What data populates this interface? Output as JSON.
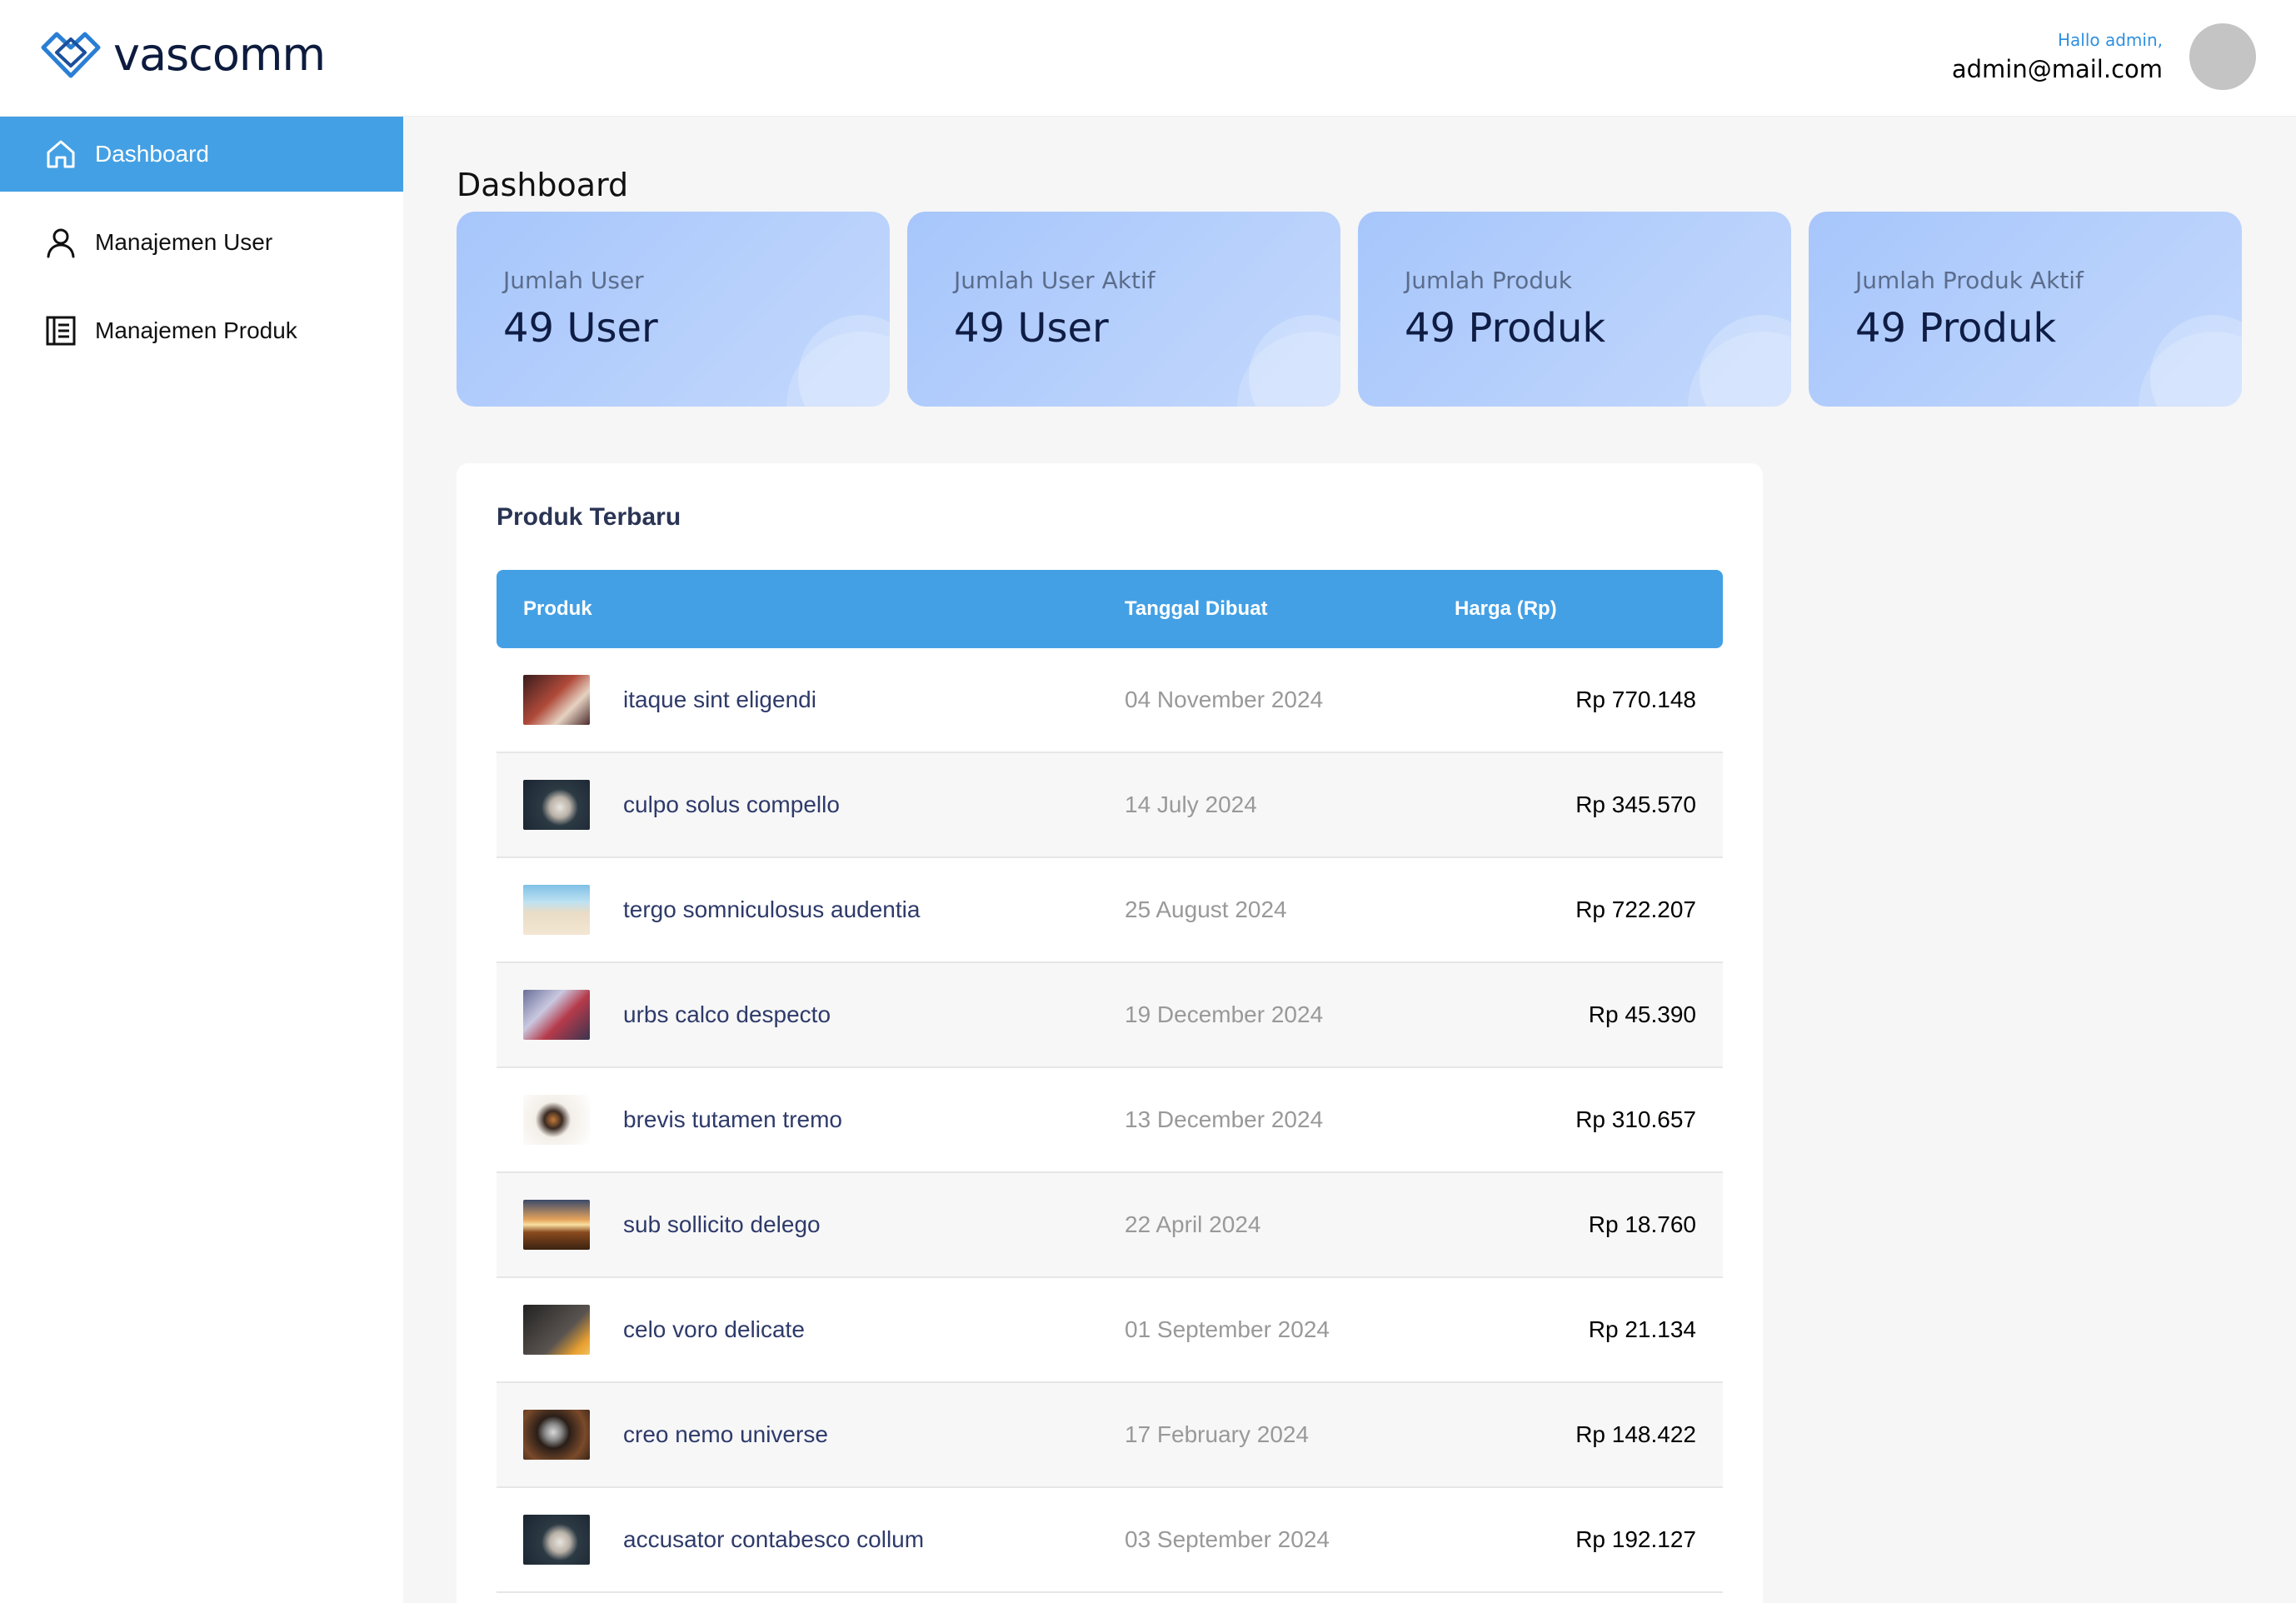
{
  "brand": {
    "name": "vascomm"
  },
  "header": {
    "greeting": "Hallo admin,",
    "email": "admin@mail.com"
  },
  "sidebar": {
    "items": [
      {
        "label": "Dashboard",
        "icon": "home-icon",
        "active": true
      },
      {
        "label": "Manajemen User",
        "icon": "user-icon",
        "active": false
      },
      {
        "label": "Manajemen Produk",
        "icon": "document-icon",
        "active": false
      }
    ]
  },
  "main": {
    "title": "Dashboard",
    "stats": [
      {
        "label": "Jumlah User",
        "value": "49 User"
      },
      {
        "label": "Jumlah User Aktif",
        "value": "49 User"
      },
      {
        "label": "Jumlah Produk",
        "value": "49 Produk"
      },
      {
        "label": "Jumlah Produk Aktif",
        "value": "49 Produk"
      }
    ],
    "products": {
      "title": "Produk Terbaru",
      "columns": [
        "Produk",
        "Tanggal Dibuat",
        "Harga (Rp)"
      ],
      "rows": [
        {
          "name": "itaque sint eligendi",
          "date": "04 November 2024",
          "price": "Rp 770.148"
        },
        {
          "name": "culpo solus compello",
          "date": "14 July 2024",
          "price": "Rp 345.570"
        },
        {
          "name": "tergo somniculosus audentia",
          "date": "25 August 2024",
          "price": "Rp 722.207"
        },
        {
          "name": "urbs calco despecto",
          "date": "19 December 2024",
          "price": "Rp 45.390"
        },
        {
          "name": "brevis tutamen tremo",
          "date": "13 December 2024",
          "price": "Rp 310.657"
        },
        {
          "name": "sub sollicito delego",
          "date": "22 April 2024",
          "price": "Rp 18.760"
        },
        {
          "name": "celo voro delicate",
          "date": "01 September 2024",
          "price": "Rp 21.134"
        },
        {
          "name": "creo nemo universe",
          "date": "17 February 2024",
          "price": "Rp 148.422"
        },
        {
          "name": "accusator contabesco collum",
          "date": "03 September 2024",
          "price": "Rp 192.127"
        }
      ]
    }
  },
  "colors": {
    "accent": "#44a0e4",
    "card_gradient_start": "#a7c6fb",
    "card_gradient_end": "#c3d8fd"
  }
}
